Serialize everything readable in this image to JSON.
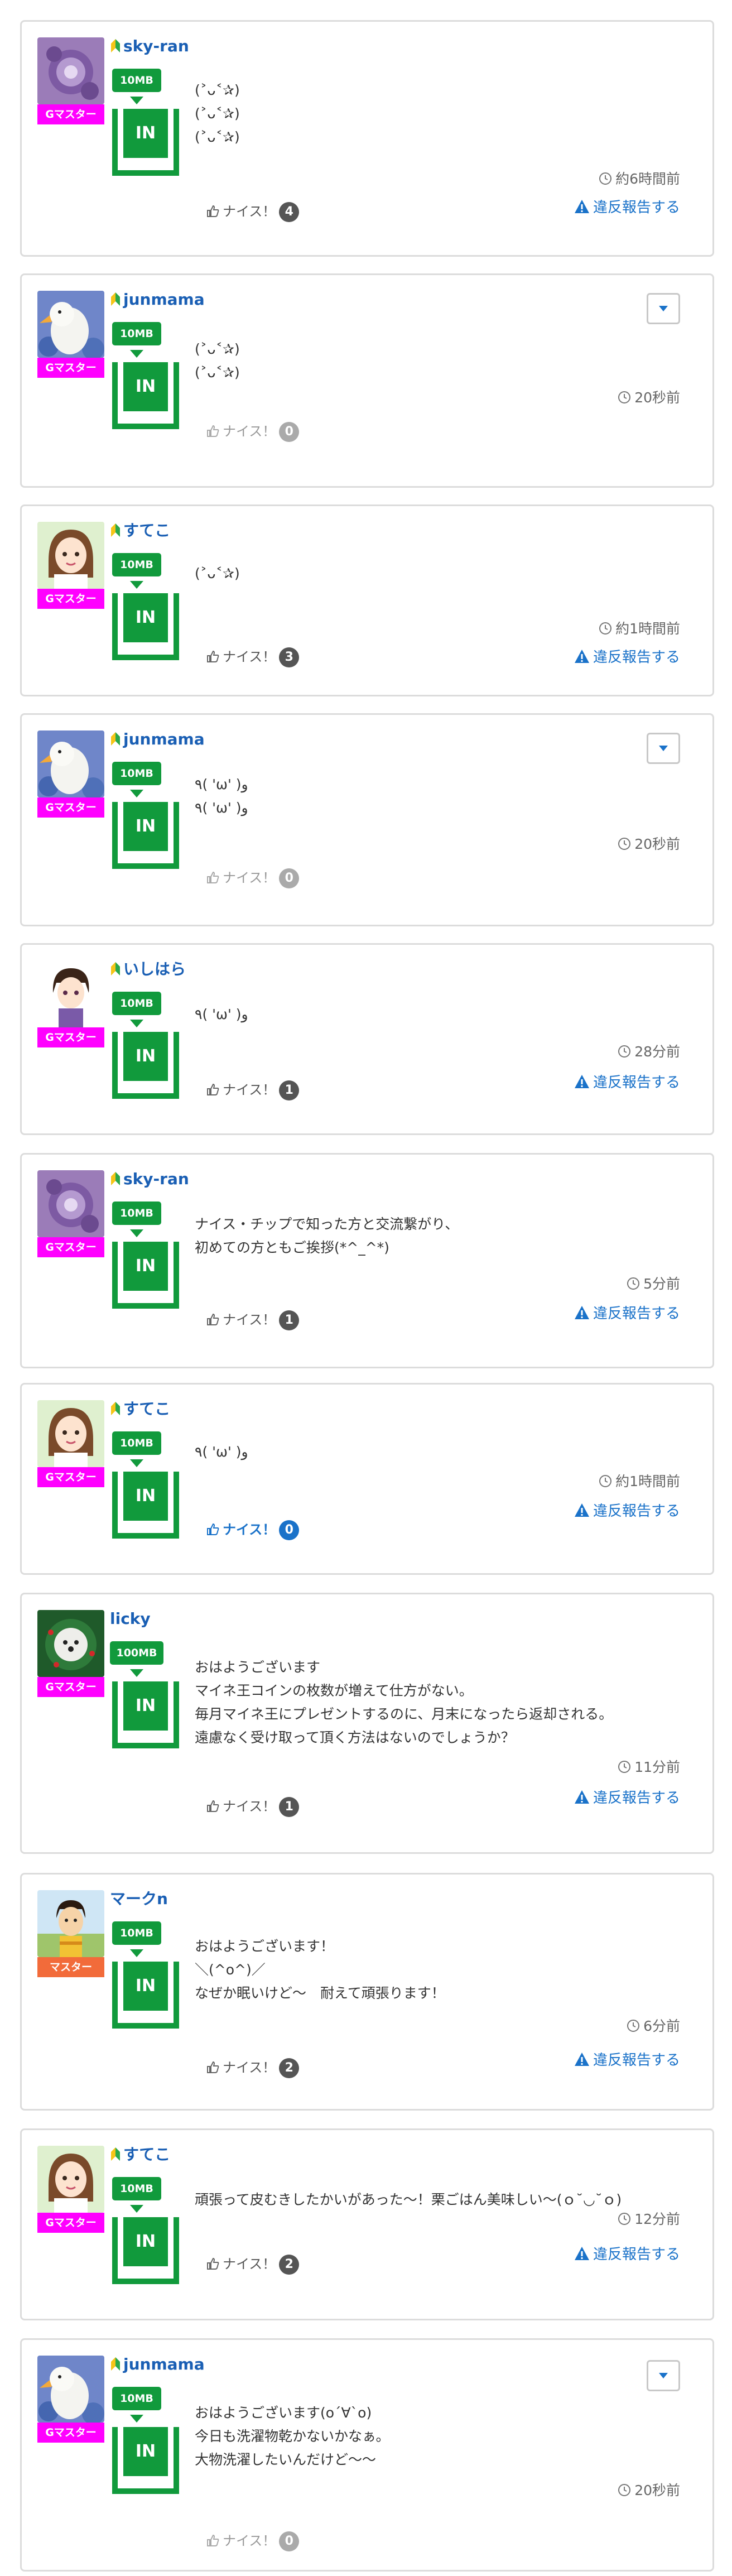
{
  "posts": [
    {
      "user": "sky-ran",
      "beginner": true,
      "badge": "Gマスター",
      "badge_color": "#ff00ff",
      "mb": "10MB",
      "in": "IN",
      "avatar": "purple-flower-icon",
      "message": "(˃ᴗ˂✰)\n(˃ᴗ˂✰)\n(˃ᴗ˂✰)",
      "time": "約6時間前",
      "nice": "ナイス！",
      "nice_count": "4",
      "nice_state": "normal",
      "report": "違反報告する",
      "menu": false
    },
    {
      "user": "junmama",
      "beginner": true,
      "badge": "Gマスター",
      "badge_color": "#ff00ff",
      "mb": "10MB",
      "in": "IN",
      "avatar": "duck-icon",
      "message": "(˃ᴗ˂✰)\n(˃ᴗ˂✰)",
      "time": "20秒前",
      "nice": "ナイス！",
      "nice_count": "0",
      "nice_state": "zero",
      "report": null,
      "menu": true
    },
    {
      "user": "すてこ",
      "beginner": true,
      "badge": "Gマスター",
      "badge_color": "#ff00ff",
      "mb": "10MB",
      "in": "IN",
      "avatar": "girl-icon",
      "message": "(˃ᴗ˂✰)",
      "time": "約1時間前",
      "nice": "ナイス！",
      "nice_count": "3",
      "nice_state": "normal",
      "report": "違反報告する",
      "menu": false
    },
    {
      "user": "junmama",
      "beginner": true,
      "badge": "Gマスター",
      "badge_color": "#ff00ff",
      "mb": "10MB",
      "in": "IN",
      "avatar": "duck-icon",
      "message": "٩( 'ω' )و\n٩( 'ω' )و",
      "time": "20秒前",
      "nice": "ナイス！",
      "nice_count": "0",
      "nice_state": "zero",
      "report": null,
      "menu": true
    },
    {
      "user": "いしはら",
      "beginner": true,
      "badge": "Gマスター",
      "badge_color": "#ff00ff",
      "mb": "10MB",
      "in": "IN",
      "avatar": "boy-icon",
      "message": "٩( 'ω' )و",
      "time": "28分前",
      "nice": "ナイス！",
      "nice_count": "1",
      "nice_state": "normal",
      "report": "違反報告する",
      "menu": false
    },
    {
      "user": "sky-ran",
      "beginner": true,
      "badge": "Gマスター",
      "badge_color": "#ff00ff",
      "mb": "10MB",
      "in": "IN",
      "avatar": "purple-flower-icon",
      "message": "ナイス・チップで知った方と交流繋がり、\n初めての方ともご挨拶(*^_^*)",
      "time": "5分前",
      "nice": "ナイス！",
      "nice_count": "1",
      "nice_state": "normal",
      "report": "違反報告する",
      "menu": false
    },
    {
      "user": "すてこ",
      "beginner": true,
      "badge": "Gマスター",
      "badge_color": "#ff00ff",
      "mb": "10MB",
      "in": "IN",
      "avatar": "girl-icon",
      "message": "٩( 'ω' )و",
      "time": "約1時間前",
      "nice": "ナイス！",
      "nice_count": "0",
      "nice_state": "active",
      "report": "違反報告する",
      "menu": false
    },
    {
      "user": "licky",
      "beginner": false,
      "badge": "Gマスター",
      "badge_color": "#ff00ff",
      "mb": "100MB",
      "in": "IN",
      "avatar": "dog-wreath-icon",
      "message": "おはようございます\nマイネ王コインの枚数が増えて仕方がない。\n毎月マイネ王にプレゼントするのに、月末になったら返却される。\n遠慮なく受け取って頂く方法はないのでしょうか？",
      "time": "11分前",
      "nice": "ナイス！",
      "nice_count": "1",
      "nice_state": "normal",
      "report": "違反報告する",
      "menu": false
    },
    {
      "user": "マークn",
      "beginner": false,
      "badge": "マスター",
      "badge_color": "#f26b3a",
      "mb": "10MB",
      "in": "IN",
      "avatar": "man-icon",
      "message": "おはようございます！\n＼(^o^)／\nなぜか眠いけど〜　耐えて頑張ります！",
      "time": "6分前",
      "nice": "ナイス！",
      "nice_count": "2",
      "nice_state": "normal",
      "report": "違反報告する",
      "menu": false
    },
    {
      "user": "すてこ",
      "beginner": true,
      "badge": "Gマスター",
      "badge_color": "#ff00ff",
      "mb": "10MB",
      "in": "IN",
      "avatar": "girl-icon",
      "message": "頑張って皮むきしたかいがあった〜！栗ごはん美味しい〜(ｏ˘◡˘ｏ)",
      "time": "12分前",
      "nice": "ナイス！",
      "nice_count": "2",
      "nice_state": "normal",
      "report": "違反報告する",
      "menu": false
    },
    {
      "user": "junmama",
      "beginner": true,
      "badge": "Gマスター",
      "badge_color": "#ff00ff",
      "mb": "10MB",
      "in": "IN",
      "avatar": "duck-icon",
      "message": "おはようございます(o´∀`o)\n今日も洗濯物乾かないかなぁ。\n大物洗濯したいんだけど〜〜",
      "time": "20秒前",
      "nice": "ナイス！",
      "nice_count": "0",
      "nice_state": "zero",
      "report": null,
      "menu": true
    }
  ]
}
